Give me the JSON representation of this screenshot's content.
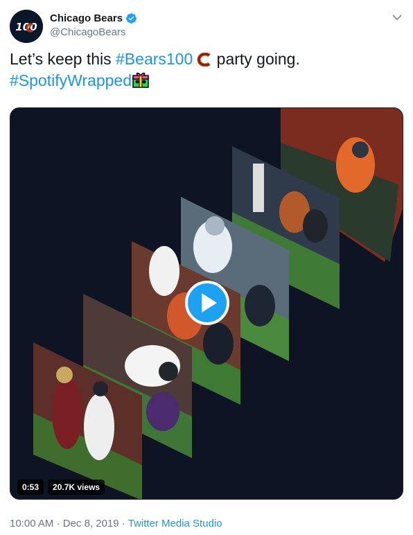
{
  "author": {
    "display_name": "Chicago Bears",
    "handle": "@ChicagoBears",
    "verified": true,
    "avatar_text": "100"
  },
  "tweet": {
    "text_before": "Let’s keep this ",
    "hashtag1": "#Bears100",
    "text_after": " party going.",
    "hashtag2": "#SpotifyWrapped"
  },
  "video": {
    "duration": "0:53",
    "views": "20.7K views"
  },
  "meta": {
    "time": "10:00 AM",
    "sep1": " · ",
    "date": "Dec 8, 2019",
    "sep2": " · ",
    "source": "Twitter Media Studio"
  },
  "colors": {
    "link": "#1b95e0",
    "play": "#1da1f2",
    "media_bg": "#0e1424",
    "bears_orange": "#c83803",
    "bears_navy": "#0b162a"
  },
  "icons": [
    "verified-icon",
    "chevron-down-icon",
    "play-icon",
    "bears-logo-icon",
    "gift-icon"
  ]
}
